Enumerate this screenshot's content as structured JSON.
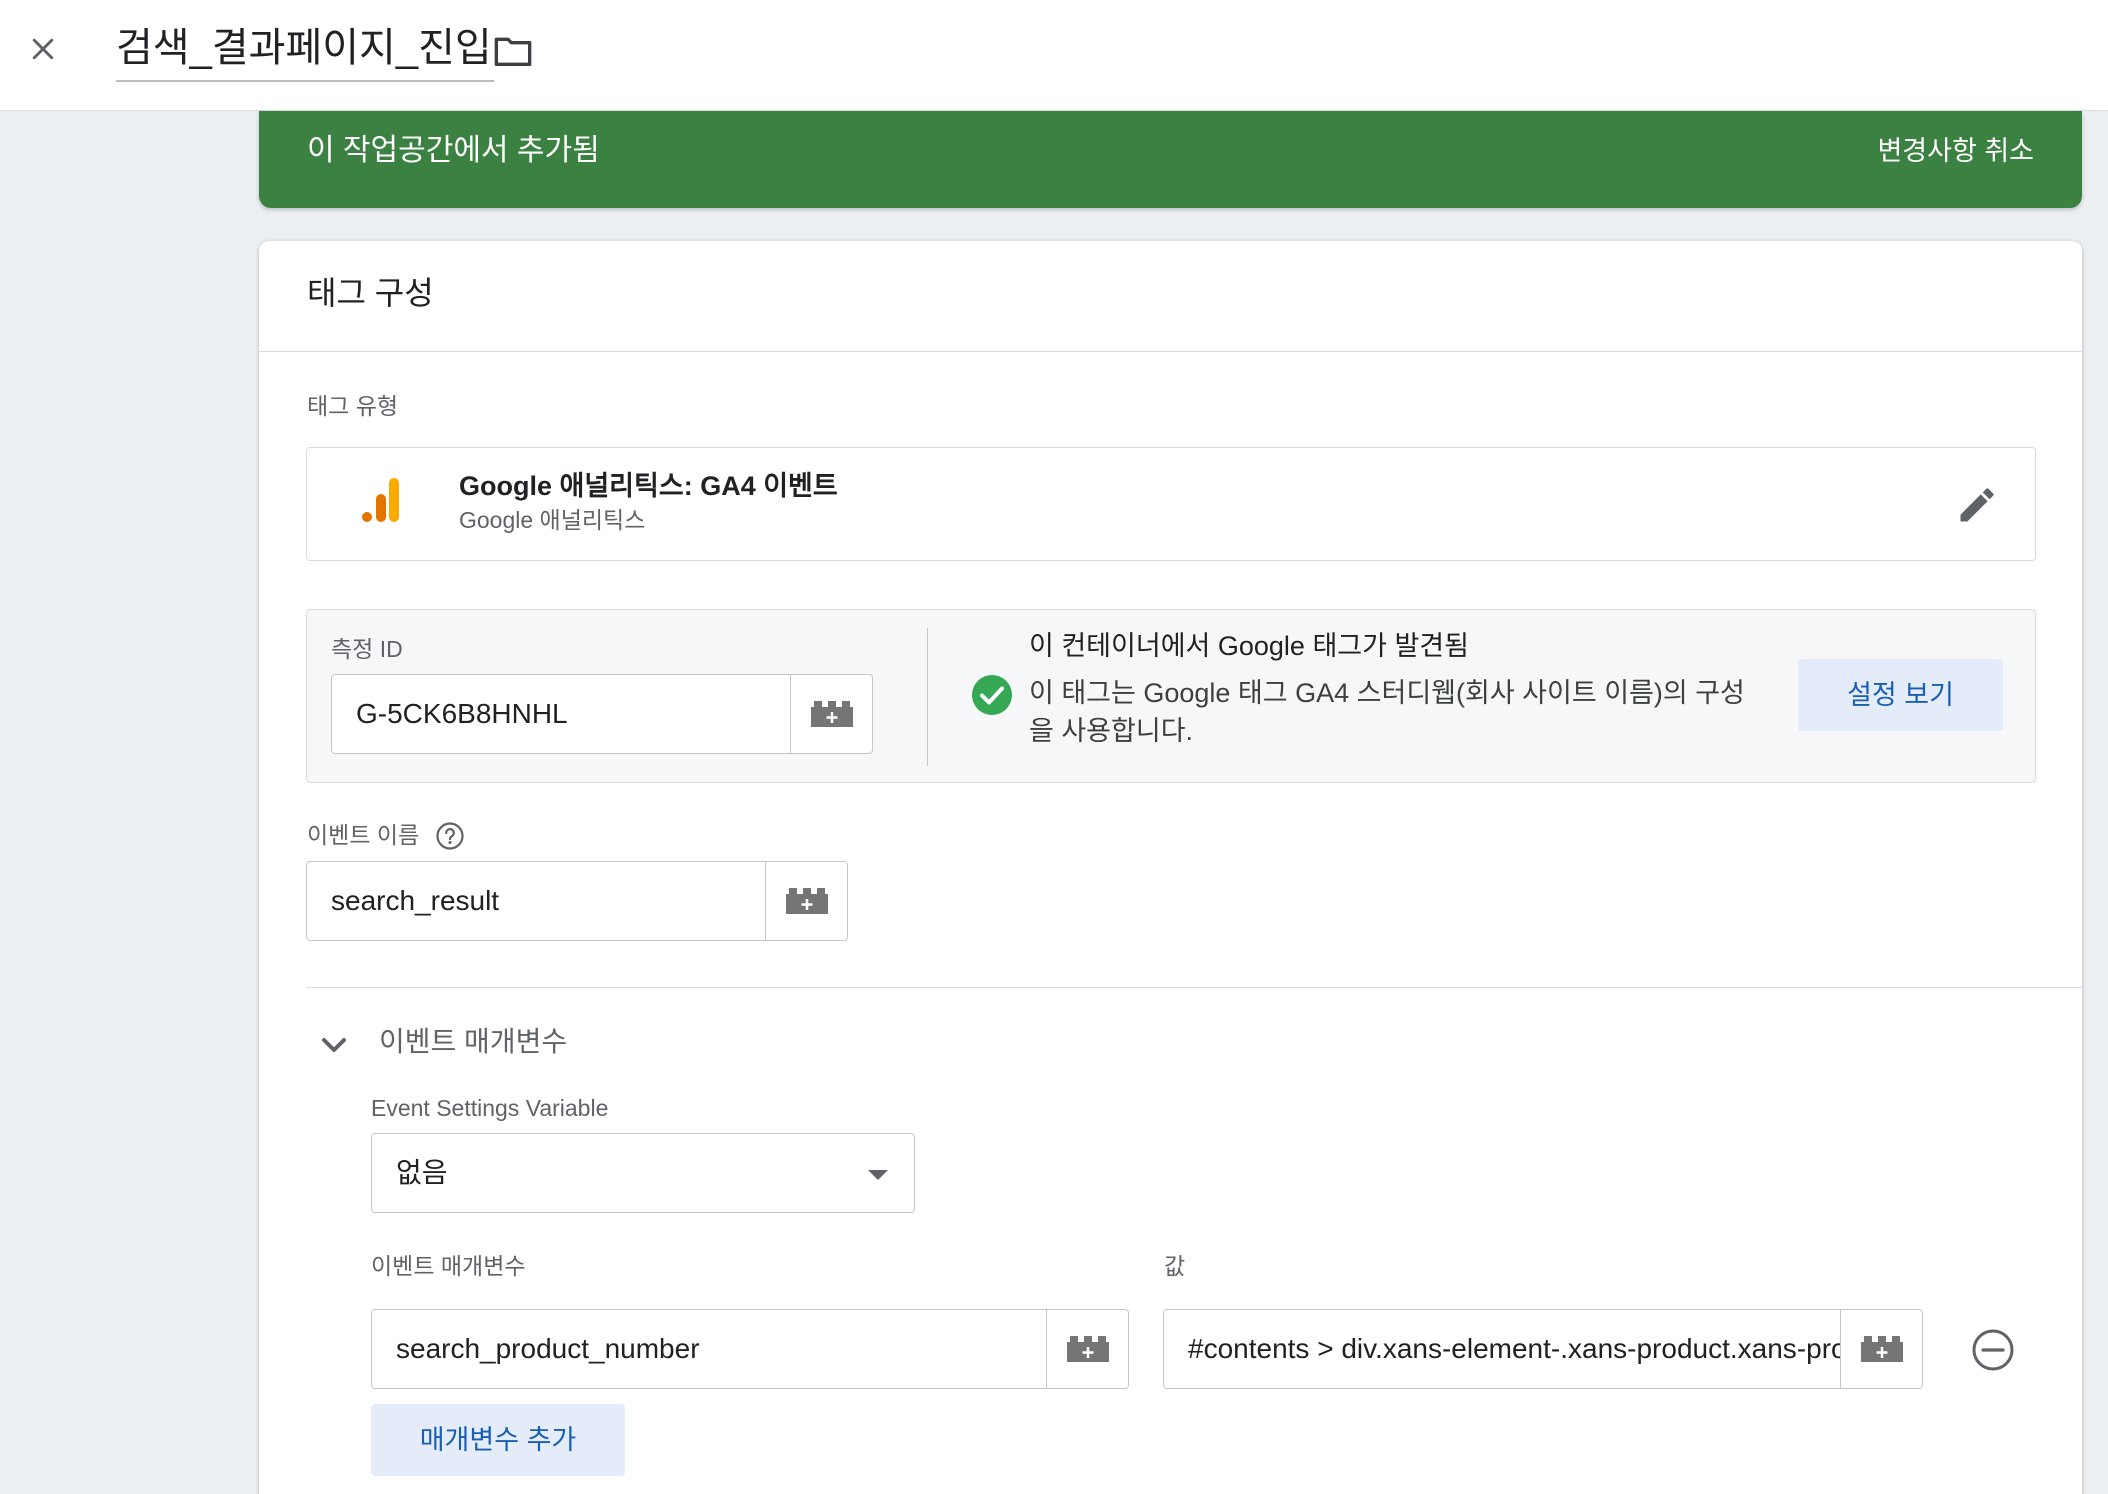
{
  "header": {
    "title": "검색_결과페이지_진입",
    "close_icon": "close-icon",
    "folder_icon": "folder-icon"
  },
  "banner": {
    "text": "이 작업공간에서 추가됨",
    "undo_label": "변경사항 취소",
    "color": "#3b8242"
  },
  "card": {
    "title": "태그 구성",
    "tag_type_label": "태그 유형",
    "tag_type": {
      "name": "Google 애널리틱스: GA4 이벤트",
      "vendor": "Google 애널리틱스",
      "icon": "google-analytics-icon"
    },
    "measurement": {
      "label": "측정 ID",
      "value": "G-5CK6B8HNHL",
      "found_title": "이 컨테이너에서 Google 태그가 발견됨",
      "found_text": "이 태그는 Google 태그 GA4 스터디웹(회사 사이트 이름)의 구성을 사용합니다.",
      "settings_button": "설정 보기"
    },
    "event_name": {
      "label": "이벤트 이름",
      "value": "search_result"
    },
    "event_params": {
      "section_title": "이벤트 매개변수",
      "settings_variable_label": "Event Settings Variable",
      "settings_variable_value": "없음",
      "param_column_label": "이벤트 매개변수",
      "value_column_label": "값",
      "rows": [
        {
          "name": "search_product_number",
          "value": "#contents > div.xans-element-.xans-product.xans-product-normalpackage"
        }
      ],
      "add_button": "매개변수 추가"
    }
  },
  "colors": {
    "accent": "#1a5fb4",
    "accent_bg": "#e3ecf8",
    "success": "#34a853",
    "ga_orange": "#f9ab00",
    "ga_dark_orange": "#e37400"
  }
}
